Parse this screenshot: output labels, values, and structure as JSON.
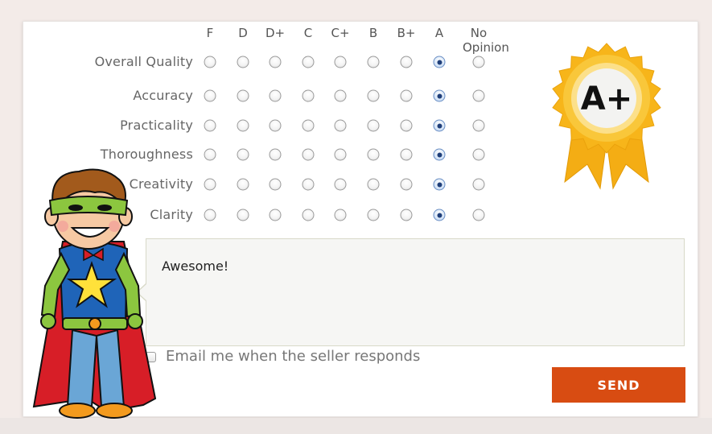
{
  "grades": [
    "F",
    "D",
    "D+",
    "C",
    "C+",
    "B",
    "B+",
    "A",
    "No Opinion"
  ],
  "criteria": [
    {
      "label": "Overall Quality",
      "selected": "A"
    },
    {
      "label": "Accuracy",
      "selected": "A"
    },
    {
      "label": "Practicality",
      "selected": "A"
    },
    {
      "label": "Thoroughness",
      "selected": "A"
    },
    {
      "label": "Creativity",
      "selected": "A"
    },
    {
      "label": "Clarity",
      "selected": "A"
    }
  ],
  "comment": {
    "value": "Awesome!"
  },
  "email": {
    "label": "Email me when the seller responds",
    "checked": false
  },
  "send": {
    "label": "SEND"
  },
  "badge": {
    "text": "A+"
  },
  "colors": {
    "accent": "#d84c12",
    "ribbon_gold": "#f6b417",
    "ribbon_light": "#fbd768"
  },
  "illustration": {
    "name": "superhero-kid-illustration"
  }
}
